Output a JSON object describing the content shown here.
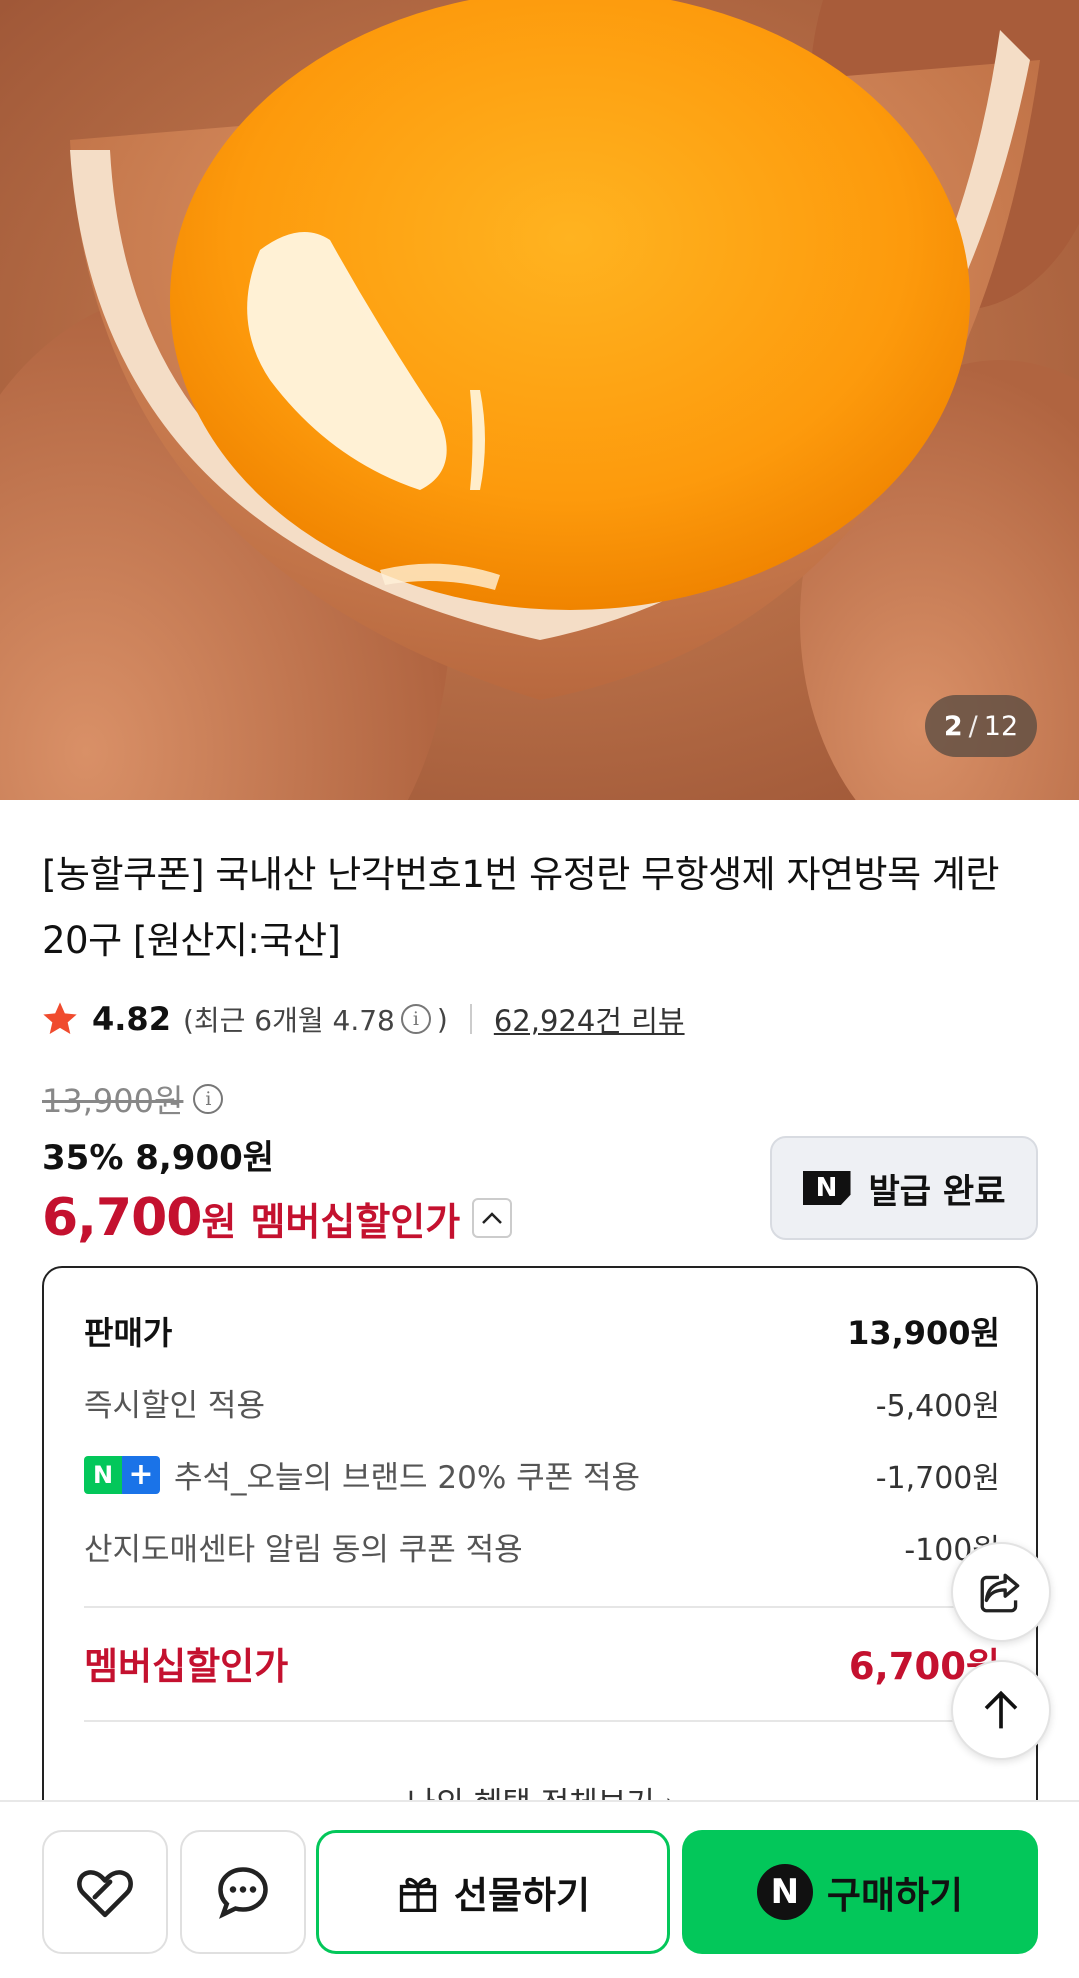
{
  "gallery": {
    "current": "2",
    "separator": "/",
    "total": "12"
  },
  "product": {
    "title": "[농할쿠폰] 국내산 난각번호1번 유정란 무항생제 자연방목 계란 20구 [원산지:국산]"
  },
  "rating": {
    "score": "4.82",
    "recent": "(최근 6개월 4.78",
    "recent_close": ")",
    "reviews": "62,924건 리뷰"
  },
  "price": {
    "original": "13,900원",
    "discount_line": "35% 8,900원",
    "member_price": "6,700",
    "member_unit": "원",
    "member_label": "멤버십할인가"
  },
  "coupon_button": {
    "label": "발급 완료",
    "badge": "N"
  },
  "breakdown": {
    "sale_label": "판매가",
    "sale_value": "13,900원",
    "rows": [
      {
        "label": "즉시할인 적용",
        "value": "-5,400원"
      },
      {
        "label": "추석_오늘의 브랜드 20% 쿠폰 적용",
        "value": "-1,700원",
        "badge_n": "N",
        "badge_plus": "+"
      },
      {
        "label": "산지도매센타 알림 동의 쿠폰 적용",
        "value": "-100원"
      }
    ],
    "member_label": "멤버십할인가",
    "member_value": "6,700원",
    "all_benefits": "나의 혜택 전체보기 ›"
  },
  "bottom_bar": {
    "gift_label": "선물하기",
    "buy_label": "구매하기",
    "buy_badge": "N"
  },
  "colors": {
    "accent_red": "#c4112f",
    "naver_green": "#03c75a",
    "star": "#f04b2e"
  },
  "icons": [
    "heart-icon",
    "chat-icon",
    "gift-icon",
    "share-icon",
    "arrow-up-icon",
    "star-icon",
    "info-icon",
    "chevron-up-icon"
  ]
}
